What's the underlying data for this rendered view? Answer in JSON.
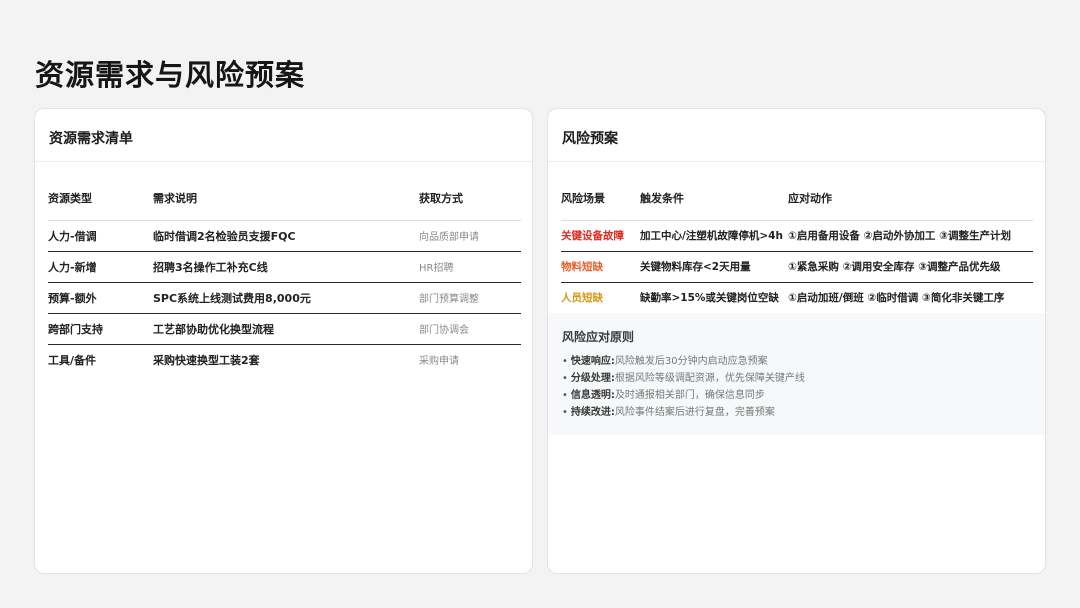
{
  "title": "资源需求与风险预案",
  "resources": {
    "title": "资源需求清单",
    "headers": [
      "资源类型",
      "需求说明",
      "获取方式"
    ],
    "rows": [
      {
        "type": "人力-借调",
        "desc": "临时借调2名检验员支援FQC",
        "method": "向品质部申请"
      },
      {
        "type": "人力-新增",
        "desc": "招聘3名操作工补充C线",
        "method": "HR招聘"
      },
      {
        "type": "预算-额外",
        "desc": "SPC系统上线测试费用8,000元",
        "method": "部门预算调整"
      },
      {
        "type": "跨部门支持",
        "desc": "工艺部协助优化换型流程",
        "method": "部门协调会"
      },
      {
        "type": "工具/备件",
        "desc": "采购快速换型工装2套",
        "method": "采购申请"
      }
    ]
  },
  "risks": {
    "title": "风险预案",
    "headers": [
      "风险场景",
      "触发条件",
      "应对动作"
    ],
    "rows": [
      {
        "scene": "关键设备故障",
        "color": "#e02a1f",
        "trigger": "加工中心/注塑机故障停机>4h",
        "action": "①启用备用设备 ②启动外协加工 ③调整生产计划"
      },
      {
        "scene": "物料短缺",
        "color": "#e8602a",
        "trigger": "关键物料库存<2天用量",
        "action": "①紧急采购 ②调用安全库存 ③调整产品优先级"
      },
      {
        "scene": "人员短缺",
        "color": "#d69a16",
        "trigger": "缺勤率>15%或关键岗位空缺",
        "action": "①启动加班/倒班 ②临时借调 ③简化非关键工序"
      }
    ]
  },
  "principles": {
    "title": "风险应对原则",
    "items": [
      {
        "key": "快速响应:",
        "text": "风险触发后30分钟内启动应急预案"
      },
      {
        "key": "分级处理:",
        "text": "根据风险等级调配资源，优先保障关键产线"
      },
      {
        "key": "信息透明:",
        "text": "及时通报相关部门，确保信息同步"
      },
      {
        "key": "持续改进:",
        "text": "风险事件结案后进行复盘，完善预案"
      }
    ]
  }
}
